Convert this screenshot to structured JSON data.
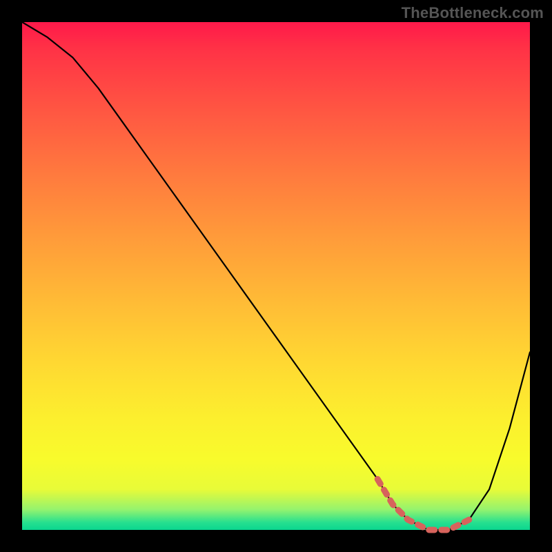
{
  "watermark": "TheBottleneck.com",
  "chart_data": {
    "type": "line",
    "title": "",
    "xlabel": "",
    "ylabel": "",
    "xlim": [
      0,
      100
    ],
    "ylim": [
      0,
      100
    ],
    "grid": false,
    "legend": false,
    "gradient_stops": [
      {
        "pos": 0,
        "color": "#ff194a"
      },
      {
        "pos": 0.18,
        "color": "#ff5842"
      },
      {
        "pos": 0.42,
        "color": "#ff9a3a"
      },
      {
        "pos": 0.67,
        "color": "#ffd832"
      },
      {
        "pos": 0.86,
        "color": "#f8fb2c"
      },
      {
        "pos": 0.96,
        "color": "#94f36e"
      },
      {
        "pos": 1.0,
        "color": "#0ad68f"
      }
    ],
    "series": [
      {
        "name": "curve",
        "color": "#000000",
        "x": [
          0,
          5,
          10,
          15,
          20,
          25,
          30,
          35,
          40,
          45,
          50,
          55,
          60,
          65,
          70,
          73,
          76,
          80,
          84,
          88,
          92,
          96,
          100
        ],
        "values": [
          100,
          97,
          93,
          87,
          80,
          73,
          66,
          59,
          52,
          45,
          38,
          31,
          24,
          17,
          10,
          5,
          2,
          0,
          0,
          2,
          8,
          20,
          35
        ]
      },
      {
        "name": "highlight-segment",
        "color": "#d7635c",
        "x": [
          70,
          73,
          76,
          80,
          84,
          88
        ],
        "values": [
          10,
          5,
          2,
          0,
          0,
          2
        ]
      }
    ]
  }
}
